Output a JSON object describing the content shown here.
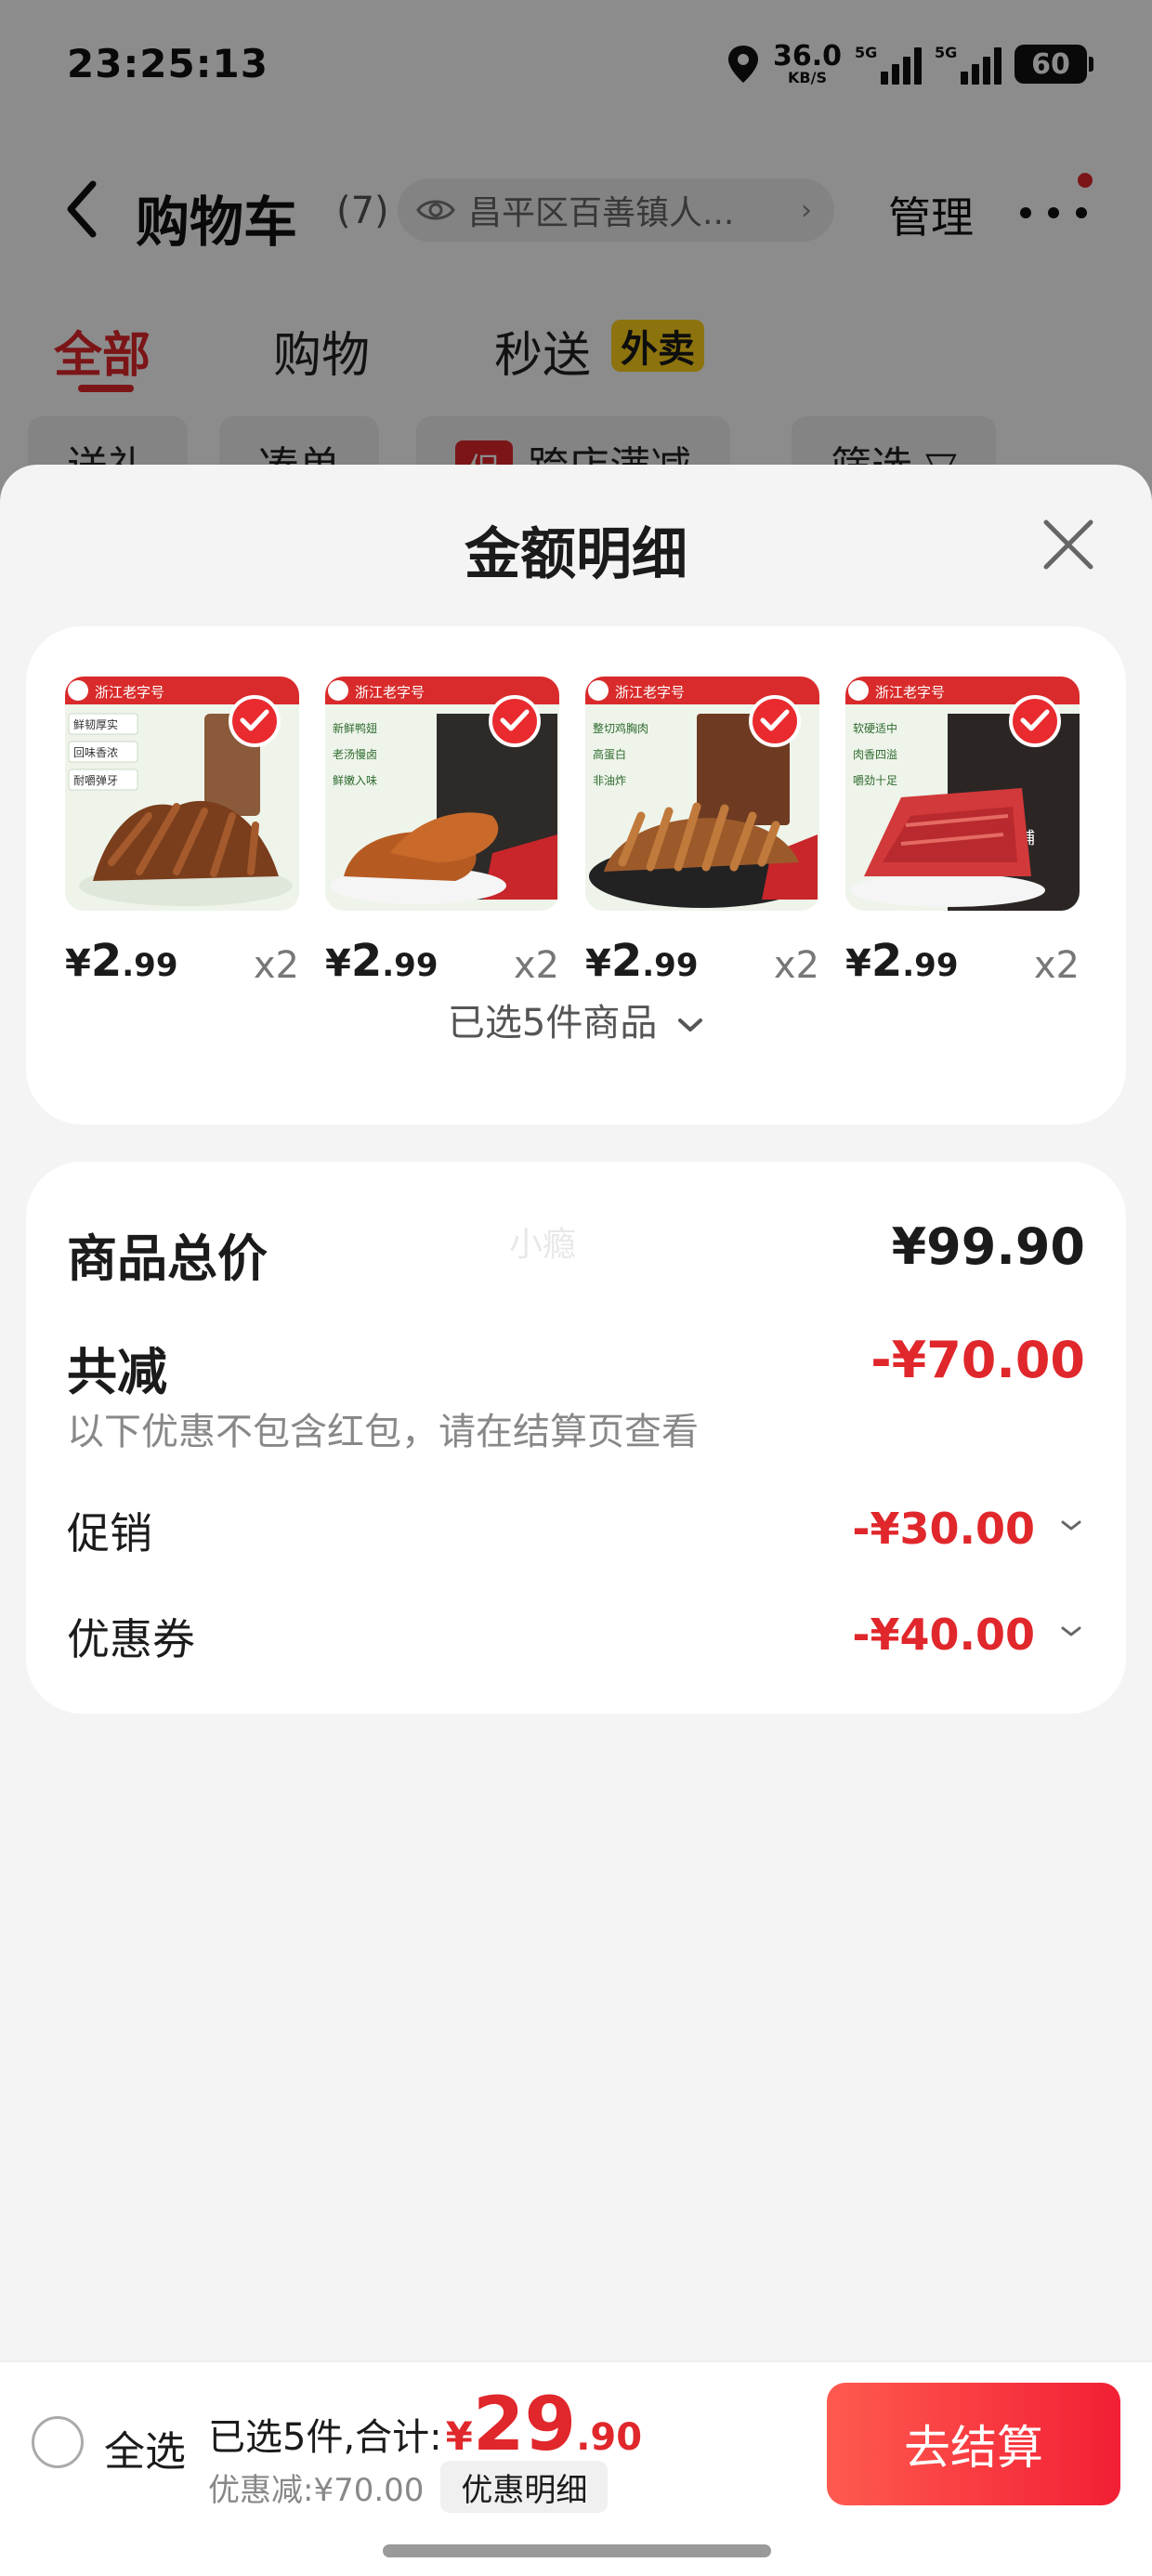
{
  "status_bar": {
    "time": "23:25:13",
    "net_speed_value": "36.0",
    "net_speed_unit": "KB/S",
    "signal1_tag": "5G",
    "signal2_tag": "5G",
    "battery": "60"
  },
  "nav": {
    "title": "购物车",
    "count": "(7)",
    "address": "昌平区百善镇人...",
    "manage_label": "管理"
  },
  "tabs": {
    "all": "全部",
    "shopping": "购物",
    "instant": "秒送",
    "takeaway_badge": "外卖"
  },
  "filters": {
    "gift": "送礼",
    "combine": "凑单",
    "promo_tag": "促",
    "cross_store": "跨店满减",
    "filter": "筛选 ▽"
  },
  "sheet": {
    "title": "金额明细",
    "products": [
      {
        "currency": "¥",
        "price_int": "2",
        "price_dec": ".99",
        "qty": "x2",
        "tags": [
          "鲜韧厚实",
          "回味香浓",
          "耐嚼弹牙"
        ],
        "brand": "浙江老字号"
      },
      {
        "currency": "¥",
        "price_int": "2",
        "price_dec": ".99",
        "qty": "x2",
        "tags": [
          "新鲜鸭翅",
          "老汤慢卤",
          "鲜嫩入味"
        ],
        "brand": "浙江老字号"
      },
      {
        "currency": "¥",
        "price_int": "2",
        "price_dec": ".99",
        "qty": "x2",
        "tags": [
          "整切鸡胸肉",
          "高蛋白",
          "非油炸"
        ],
        "brand": "浙江老字号"
      },
      {
        "currency": "¥",
        "price_int": "2",
        "price_dec": ".99",
        "qty": "x2",
        "tags": [
          "软硬适中",
          "肉香四溢",
          "嚼劲十足"
        ],
        "brand": "浙江老字号",
        "pack_text": "猪肉脯"
      }
    ],
    "selected_summary": "已选5件商品",
    "watermark": "小瘾",
    "totals": {
      "goods_total_label": "商品总价",
      "goods_total_value": "¥99.90",
      "reduction_label": "共减",
      "reduction_value": "-¥70.00",
      "note": "以下优惠不包含红包，请在结算页查看",
      "promo_label": "促销",
      "promo_value": "-¥30.00",
      "coupon_label": "优惠券",
      "coupon_value": "-¥40.00"
    }
  },
  "bottom_bar": {
    "select_all": "全选",
    "summary_prefix": "已选5件,合计:",
    "currency": "¥",
    "total_int": "29",
    "total_dec": ".90",
    "discount_text": "优惠减:¥70.00",
    "detail_button": "优惠明细",
    "checkout_button": "去结算"
  },
  "colors": {
    "accent_red": "#e0272b",
    "checkout_gradient_start": "#ff5a4f",
    "checkout_gradient_end": "#f21f34",
    "takeaway_badge": "#ffd21a"
  }
}
